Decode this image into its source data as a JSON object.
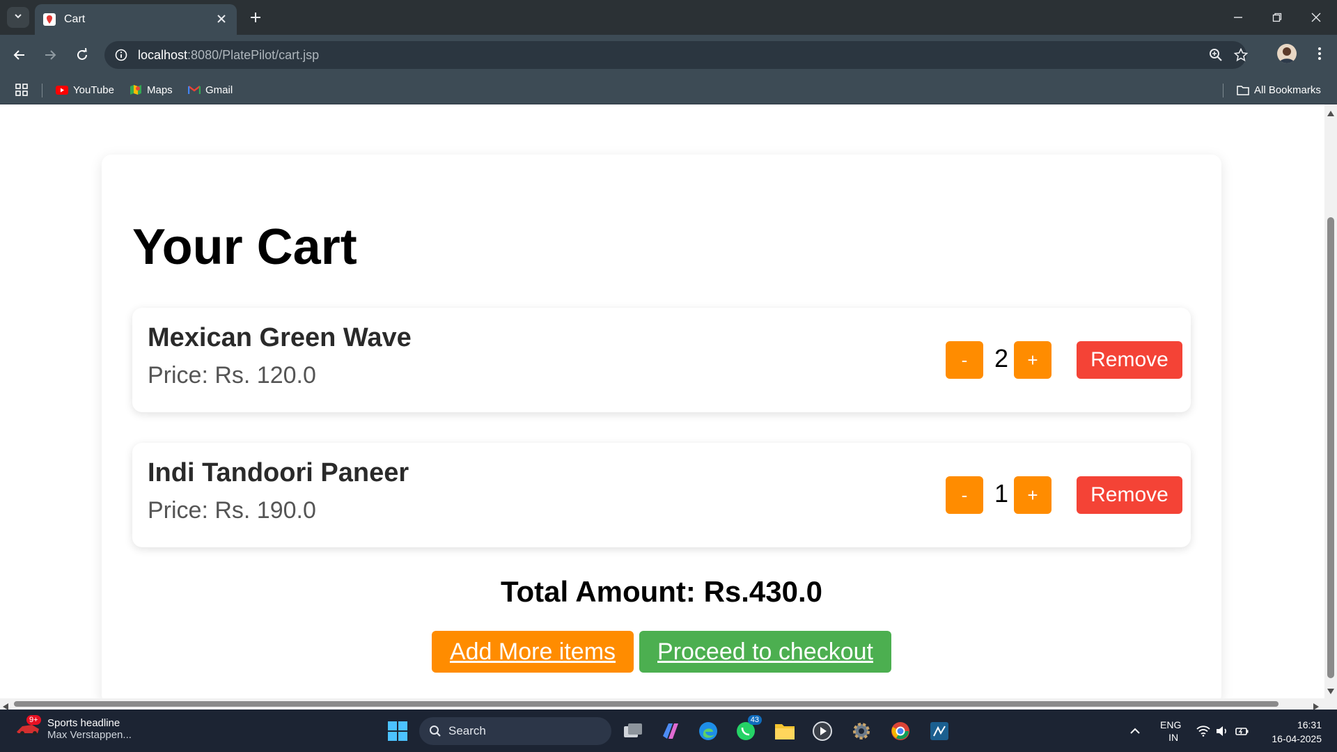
{
  "browser": {
    "tab_title": "Cart",
    "url_host": "localhost",
    "url_path": ":8080/PlatePilot/cart.jsp",
    "bookmarks": [
      {
        "label": "YouTube",
        "icon": "youtube-icon"
      },
      {
        "label": "Maps",
        "icon": "maps-icon"
      },
      {
        "label": "Gmail",
        "icon": "gmail-icon"
      }
    ],
    "all_bookmarks_label": "All Bookmarks"
  },
  "cart": {
    "title": "Your Cart",
    "items": [
      {
        "name": "Mexican Green Wave",
        "price": "Price: Rs. 120.0",
        "quantity": "2",
        "decrease": "-",
        "increase": "+",
        "remove": "Remove"
      },
      {
        "name": "Indi Tandoori Paneer",
        "price": "Price: Rs. 190.0",
        "quantity": "1",
        "decrease": "-",
        "increase": "+",
        "remove": "Remove"
      }
    ],
    "total": "Total Amount: Rs.430.0",
    "add_more_label": "Add More items",
    "checkout_label": "Proceed to checkout"
  },
  "taskbar": {
    "news_badge": "9+",
    "news_title": "Sports headline",
    "news_subtitle": "Max Verstappen...",
    "search_placeholder": "Search",
    "whatsapp_badge": "43",
    "language": "ENG",
    "region": "IN",
    "time": "16:31",
    "date": "16-04-2025"
  },
  "colors": {
    "orange": "#ff8c00",
    "red": "#f44336",
    "green": "#4caf50",
    "chrome_dark": "#2b3135",
    "chrome_toolbar": "#3d4b55"
  }
}
